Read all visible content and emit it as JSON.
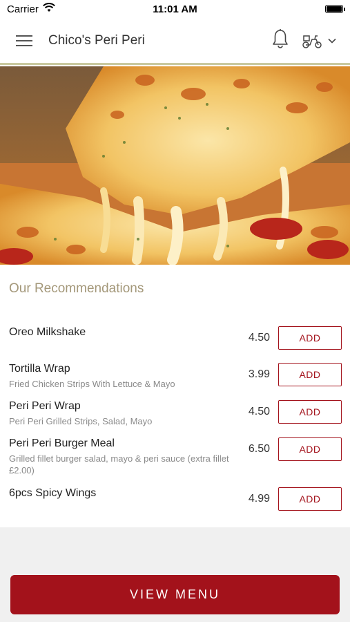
{
  "status": {
    "carrier": "Carrier",
    "time": "11:01 AM"
  },
  "header": {
    "title": "Chico's Peri Peri"
  },
  "section": {
    "title": "Our Recommendations"
  },
  "items": [
    {
      "name": "Oreo Milkshake",
      "desc": "",
      "price": "4.50",
      "button": "ADD"
    },
    {
      "name": "Tortilla Wrap",
      "desc": "Fried Chicken Strips With Lettuce & Mayo",
      "price": "3.99",
      "button": "ADD"
    },
    {
      "name": "Peri Peri Wrap",
      "desc": "Peri Peri Grilled Strips, Salad, Mayo",
      "price": "4.50",
      "button": "ADD"
    },
    {
      "name": "Peri Peri Burger Meal",
      "desc": "Grilled fillet burger salad, mayo & peri sauce (extra fillet £2.00)",
      "price": "6.50",
      "button": "ADD"
    },
    {
      "name": "6pcs Spicy Wings",
      "desc": "",
      "price": "4.99",
      "button": "ADD"
    }
  ],
  "footer": {
    "button": "VIEW MENU"
  },
  "colors": {
    "accent": "#a3121b",
    "section_title": "#a4987a"
  }
}
